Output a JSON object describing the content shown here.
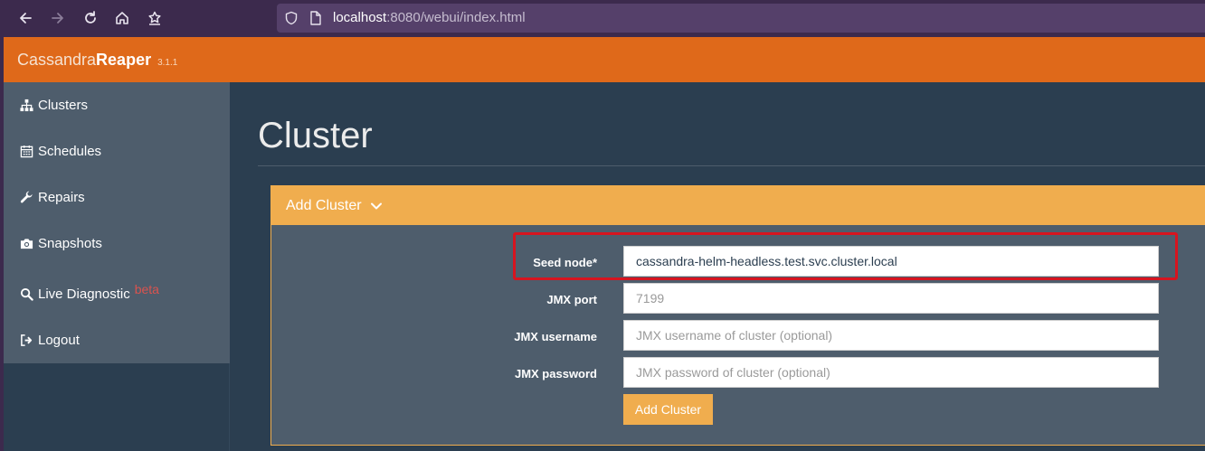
{
  "browser": {
    "url_host": "localhost",
    "url_rest": ":8080/webui/index.html"
  },
  "brand": {
    "name_light": "Cassandra",
    "name_bold": "Reaper",
    "version": "3.1.1"
  },
  "sidebar": {
    "items": [
      {
        "label": "Clusters",
        "icon": "sitemap-icon"
      },
      {
        "label": "Schedules",
        "icon": "calendar-icon"
      },
      {
        "label": "Repairs",
        "icon": "wrench-icon"
      },
      {
        "label": "Snapshots",
        "icon": "camera-icon"
      },
      {
        "label": "Live Diagnostic",
        "icon": "search-icon",
        "badge": "beta"
      },
      {
        "label": "Logout",
        "icon": "sign-out-icon"
      }
    ]
  },
  "main": {
    "title": "Cluster",
    "panel": {
      "heading": "Add Cluster",
      "fields": [
        {
          "label": "Seed node*",
          "value": "cassandra-helm-headless.test.svc.cluster.local",
          "placeholder": ""
        },
        {
          "label": "JMX port",
          "value": "",
          "placeholder": "7199"
        },
        {
          "label": "JMX username",
          "value": "",
          "placeholder": "JMX username of cluster (optional)"
        },
        {
          "label": "JMX password",
          "value": "",
          "placeholder": "JMX password of cluster (optional)"
        }
      ],
      "submit_label": "Add Cluster"
    }
  },
  "colors": {
    "brand_orange": "#df691a",
    "panel_warning": "#f0ad4e",
    "highlight_red": "#d7141f",
    "background": "#2b3e50",
    "sidebar": "#4e5d6c"
  }
}
